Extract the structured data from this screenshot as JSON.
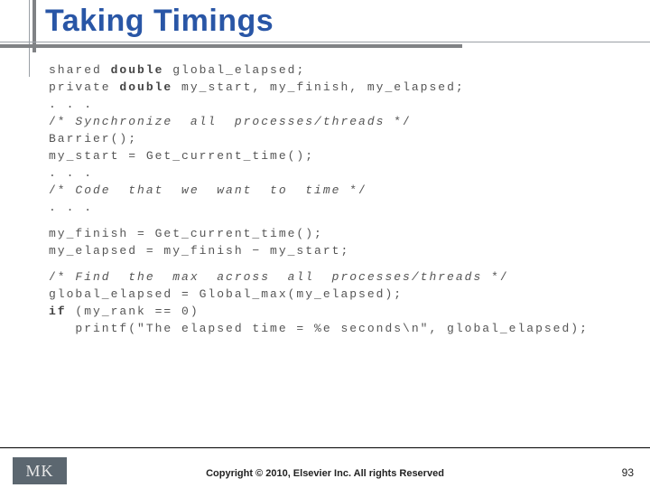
{
  "title": "Taking Timings",
  "code": {
    "l01": {
      "prefix": "shared ",
      "kw": "double",
      "rest": " global_elapsed;"
    },
    "l02": {
      "prefix": "private ",
      "kw": "double",
      "rest": " my_start, my_finish, my_elapsed;"
    },
    "l03": ". . .",
    "l04": {
      "open": "/* ",
      "body": "Synchronize  all  processes/threads",
      "close": " */"
    },
    "l05": "Barrier();",
    "l06": "my_start = Get_current_time();",
    "l07": ". . .",
    "l08": {
      "open": "/* ",
      "body": "Code  that  we  want  to  time",
      "close": " */"
    },
    "l09": ". . .",
    "l10": "my_finish = Get_current_time();",
    "l11": "my_elapsed = my_finish − my_start;",
    "l12": {
      "open": "/* ",
      "body": "Find  the  max  across  all  processes/threads",
      "close": " */"
    },
    "l13": "global_elapsed = Global_max(my_elapsed);",
    "l14": {
      "kw": "if",
      "rest": " (my_rank == 0)"
    },
    "l15": "   printf(\"The elapsed time = %e seconds\\n\", global_elapsed);"
  },
  "footer": {
    "copyright": "Copyright © 2010, Elsevier Inc. All rights Reserved",
    "page": "93",
    "logo_text": "MK"
  }
}
